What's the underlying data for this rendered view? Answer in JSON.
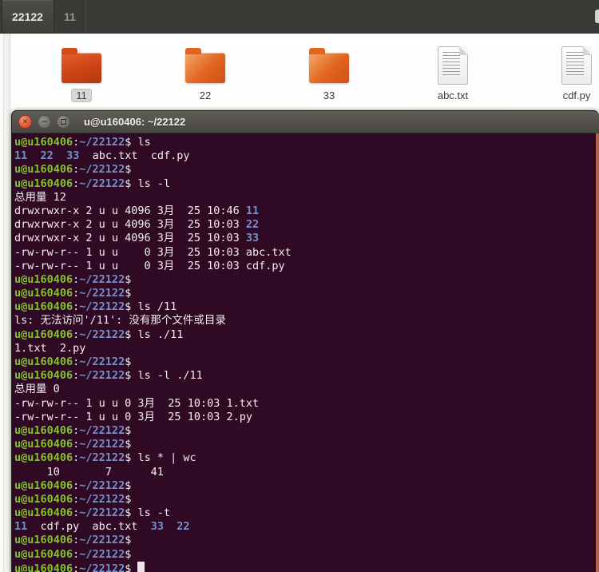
{
  "colors": {
    "tabbar_bg": "#3a3935",
    "term_bg": "#300a24",
    "term_green": "#83c12e",
    "term_blue": "#7590cc",
    "term_white": "#f2eef1",
    "cursor": "#efe2eb",
    "titlebar_top": "#605e57",
    "titlebar_bottom": "#494741",
    "close_button": "#df4f32",
    "scrollbar": "#b5624a",
    "folder_orange": "#e2641f",
    "folder_dark": "#cc4315",
    "selection_pill": "#d7d7d5"
  },
  "tabbar": {
    "tabs": [
      {
        "label": "22122",
        "active": true
      },
      {
        "label": "11",
        "active": false
      }
    ]
  },
  "filemanager": {
    "items": [
      {
        "label": "11",
        "type": "folder",
        "selected": true
      },
      {
        "label": "22",
        "type": "folder",
        "selected": false
      },
      {
        "label": "33",
        "type": "folder",
        "selected": false
      },
      {
        "label": "abc.txt",
        "type": "file",
        "selected": false
      },
      {
        "label": "cdf.py",
        "type": "file",
        "selected": false
      }
    ]
  },
  "terminal": {
    "title": "u@u160406: ~/22122",
    "window_buttons": {
      "close": "✕",
      "minimize": "−",
      "maximize": "▢"
    },
    "prompt": {
      "user": "u@u160406",
      "sep": ":",
      "path": "~/22122",
      "sign": "$"
    },
    "lines": [
      {
        "p": "ls"
      },
      {
        "segs": [
          [
            "b",
            "11"
          ],
          [
            "w",
            "  "
          ],
          [
            "b",
            "22"
          ],
          [
            "w",
            "  "
          ],
          [
            "b",
            "33"
          ],
          [
            "w",
            "  abc.txt  cdf.py"
          ]
        ]
      },
      {
        "p": ""
      },
      {
        "p": "ls -l"
      },
      {
        "segs": [
          [
            "w",
            "总用量 12"
          ]
        ]
      },
      {
        "segs": [
          [
            "w",
            "drwxrwxr-x 2 u u 4096 3月  25 10:46 "
          ],
          [
            "b",
            "11"
          ]
        ]
      },
      {
        "segs": [
          [
            "w",
            "drwxrwxr-x 2 u u 4096 3月  25 10:03 "
          ],
          [
            "b",
            "22"
          ]
        ]
      },
      {
        "segs": [
          [
            "w",
            "drwxrwxr-x 2 u u 4096 3月  25 10:03 "
          ],
          [
            "b",
            "33"
          ]
        ]
      },
      {
        "segs": [
          [
            "w",
            "-rw-rw-r-- 1 u u    0 3月  25 10:03 abc.txt"
          ]
        ]
      },
      {
        "segs": [
          [
            "w",
            "-rw-rw-r-- 1 u u    0 3月  25 10:03 cdf.py"
          ]
        ]
      },
      {
        "p": ""
      },
      {
        "p": ""
      },
      {
        "p": "ls /11"
      },
      {
        "segs": [
          [
            "w",
            "ls: 无法访问'/11': 没有那个文件或目录"
          ]
        ]
      },
      {
        "p": "ls ./11"
      },
      {
        "segs": [
          [
            "w",
            "1.txt  2.py"
          ]
        ]
      },
      {
        "p": ""
      },
      {
        "p": "ls -l ./11"
      },
      {
        "segs": [
          [
            "w",
            "总用量 0"
          ]
        ]
      },
      {
        "segs": [
          [
            "w",
            "-rw-rw-r-- 1 u u 0 3月  25 10:03 1.txt"
          ]
        ]
      },
      {
        "segs": [
          [
            "w",
            "-rw-rw-r-- 1 u u 0 3月  25 10:03 2.py"
          ]
        ]
      },
      {
        "p": ""
      },
      {
        "p": ""
      },
      {
        "p": "ls * | wc"
      },
      {
        "segs": [
          [
            "w",
            "     10       7      41"
          ]
        ]
      },
      {
        "p": ""
      },
      {
        "p": ""
      },
      {
        "p": "ls -t"
      },
      {
        "segs": [
          [
            "b",
            "11"
          ],
          [
            "w",
            "  cdf.py  abc.txt  "
          ],
          [
            "b",
            "33"
          ],
          [
            "w",
            "  "
          ],
          [
            "b",
            "22"
          ]
        ]
      },
      {
        "p": ""
      },
      {
        "p": ""
      },
      {
        "p": "",
        "cursor": true
      }
    ]
  }
}
